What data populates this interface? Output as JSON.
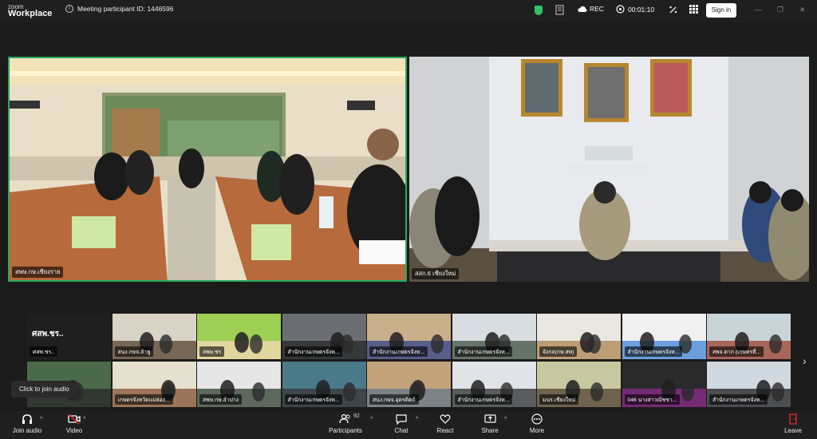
{
  "app": {
    "logo_line1": "zoom",
    "logo_line2": "Workplace",
    "meeting_info": "Meeting participant ID: 1446596",
    "rec_label": "REC",
    "timer": "00:01:10",
    "signin_label": "Sign in"
  },
  "main_videos": [
    {
      "name": "สพษ.กษ.เชียงราย"
    },
    {
      "name": "สสก.6 เชียงใหม่"
    }
  ],
  "gallery": {
    "tiles": [
      {
        "name": "ศสพ.ชร..",
        "big_label": "ศสพ.ชร..",
        "has_video": false
      },
      {
        "name": "สนง.กษจ.ลำพู",
        "has_video": true
      },
      {
        "name": "สพษ.ชร",
        "has_video": true
      },
      {
        "name": "สำนักงานเกษตรจังห...",
        "has_video": true
      },
      {
        "name": "สำนักงานเกษตรจังห...",
        "has_video": true
      },
      {
        "name": "สำนักงานเกษตรจังห...",
        "has_video": true
      },
      {
        "name": "จังกล(กษ.สพ)",
        "has_video": true
      },
      {
        "name": "สำนักงานเกษตรจังห...",
        "has_video": true
      },
      {
        "name": "สพจ.ตาก (เกษตรที่...",
        "has_video": true
      },
      {
        "name": "",
        "has_video": true
      },
      {
        "name": "เกษตรจังหวัดแม่ฮ่อง...",
        "has_video": true
      },
      {
        "name": "สพษ.กษ.ลำปาง",
        "has_video": true
      },
      {
        "name": "สำนักงานเกษตรจังห...",
        "has_video": true
      },
      {
        "name": "สนง.กษจ.อุตรดิตถ์",
        "has_video": true
      },
      {
        "name": "สำนักงานเกษตรจังห...",
        "has_video": true
      },
      {
        "name": "มนร.เชียงใหม่",
        "has_video": true
      },
      {
        "name": "046 นางสาวณัชชา...",
        "has_video": true
      },
      {
        "name": "สำนักงานเกษตรจังห...",
        "has_video": true
      }
    ]
  },
  "tooltip": "Click to join audio",
  "toolbar": {
    "join_audio": "Join audio",
    "video": "Video",
    "participants": "Participants",
    "participants_count": "92",
    "chat": "Chat",
    "react": "React",
    "share": "Share",
    "more": "More",
    "leave": "Leave"
  }
}
